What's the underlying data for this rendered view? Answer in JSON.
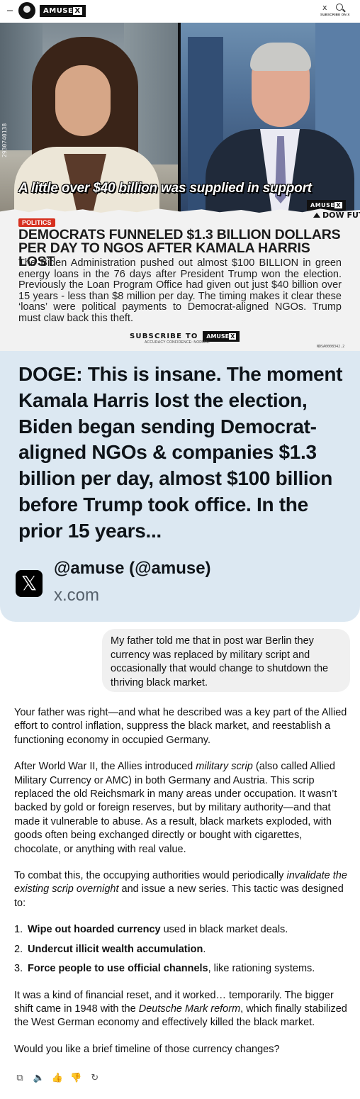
{
  "preview": {
    "topbar": {
      "logo_text_1": "AMUSE",
      "logo_text_2": "X",
      "close_glyph": "x",
      "subscribe_small": "SUBSCRIBE ON X"
    },
    "video": {
      "side_number": "2930740138",
      "caption": "A little over $40 billion was supplied in support",
      "logo_1": "AMUSE",
      "logo_2": "X"
    },
    "ticker": "DOW FUT",
    "tag": "POLITICS",
    "headline": "DEMOCRATS FUNNELED $1.3 BILLION DOLLARS PER DAY TO NGOS AFTER KAMALA HARRIS LOST",
    "body": "The Biden Administration pushed out almost $100 BILLION in green energy loans in the 76 days after President Trump won the election. Previously the Loan Program Office had given out just $40 billion over 15 years - less than $8 million per day. The timing makes it clear these ‘loans’ were political payments to Democrat-aligned NGOs. Trump must claw back this theft.",
    "subscribe_label": "SUBSCRIBE TO",
    "subscribe_logo_1": "AMUSE",
    "subscribe_logo_2": "X",
    "accuracy": "ACCURACY CONFIDENCE: NORMAL",
    "ref": "NDSA0008342.2",
    "title": "DOGE: This is insane. The moment Kamala Harris lost the election, Biden began sending Democrat-aligned NGOs & companies $1.3 billion per day, almost $100 billion before Trump took office. In the prior 15 years...",
    "source_icon": "x-logo-icon",
    "source_name": "@amuse (@amuse)",
    "source_domain": "x.com"
  },
  "chat": {
    "user_message": "My father told me that in post war Berlin they currency was replaced by military script and occasionally that would change to shutdown the thriving black market.",
    "p1": "Your father was right—and what he described was a key part of the Allied effort to control inflation, suppress the black market, and reestablish a functioning economy in occupied Germany.",
    "p2_a": "After World War II, the Allies introduced ",
    "p2_em": "military scrip",
    "p2_b": " (also called Allied Military Currency or AMC) in both Germany and Austria. This scrip replaced the old Reichsmark in many areas under occupation. It wasn’t backed by gold or foreign reserves, but by military authority—and that made it vulnerable to abuse. As a result, black markets exploded, with goods often being exchanged directly or bought with cigarettes, chocolate, or anything with real value.",
    "p3_a": "To combat this, the occupying authorities would periodically ",
    "p3_em": "invalidate the existing scrip overnight",
    "p3_b": " and issue a new series. This tactic was designed to:",
    "list": [
      {
        "num": "1.",
        "bold": "Wipe out hoarded currency",
        "rest": " used in black market deals."
      },
      {
        "num": "2.",
        "bold": "Undercut illicit wealth accumulation",
        "rest": "."
      },
      {
        "num": "3.",
        "bold": "Force people to use official channels",
        "rest": ", like rationing systems."
      }
    ],
    "p4_a": "It was a kind of financial reset, and it worked… temporarily. The bigger shift came in 1948 with the ",
    "p4_em": "Deutsche Mark reform",
    "p4_b": ", which finally stabilized the West German economy and effectively killed the black market.",
    "p5": "Would you like a brief timeline of those currency changes?"
  },
  "actions": {
    "icons": [
      "copy-icon",
      "read-aloud-icon",
      "thumbs-up-icon",
      "thumbs-down-icon",
      "regenerate-icon"
    ]
  }
}
